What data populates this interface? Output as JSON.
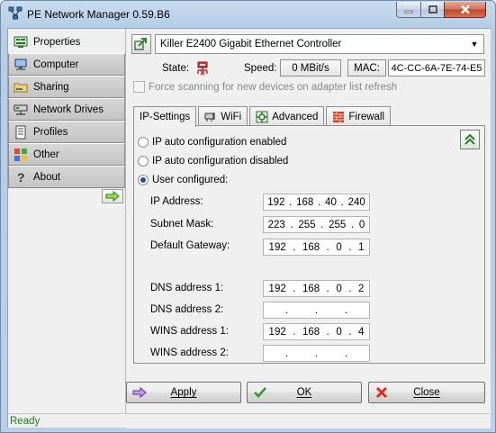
{
  "window": {
    "title": "PE Network Manager 0.59.B6"
  },
  "sidebar": {
    "items": [
      {
        "label": "Properties",
        "icon": "properties-icon"
      },
      {
        "label": "Computer",
        "icon": "computer-icon"
      },
      {
        "label": "Sharing",
        "icon": "sharing-icon"
      },
      {
        "label": "Network Drives",
        "icon": "network-drives-icon"
      },
      {
        "label": "Profiles",
        "icon": "profiles-icon"
      },
      {
        "label": "Other",
        "icon": "other-icon"
      },
      {
        "label": "About",
        "icon": "about-icon"
      }
    ],
    "active_index": 0
  },
  "adapter": {
    "selected": "Killer E2400 Gigabit Ethernet Controller",
    "state_label": "State:",
    "speed_label": "Speed:",
    "speed_value": "0 MBit/s",
    "mac_label": "MAC:",
    "mac_value": "4C-CC-6A-7E-74-E5",
    "force_scan_label": "Force scanning for new devices on adapter list refresh",
    "force_scan_checked": false,
    "force_scan_enabled": false
  },
  "tabs": [
    {
      "label": "IP-Settings",
      "active": true
    },
    {
      "label": "WiFi",
      "active": false
    },
    {
      "label": "Advanced",
      "active": false
    },
    {
      "label": "Firewall",
      "active": false
    }
  ],
  "ip_settings": {
    "radio_auto_enabled": "IP auto configuration enabled",
    "radio_auto_disabled": "IP auto configuration disabled",
    "radio_user": "User configured:",
    "selected_mode": "user",
    "ip_address_label": "IP Address:",
    "ip_address": [
      "192",
      "168",
      "40",
      "240"
    ],
    "subnet_mask_label": "Subnet Mask:",
    "subnet_mask": [
      "223",
      "255",
      "255",
      "0"
    ],
    "gateway_label": "Default Gateway:",
    "gateway": [
      "192",
      "168",
      "0",
      "1"
    ],
    "dns1_label": "DNS address 1:",
    "dns1": [
      "192",
      "168",
      "0",
      "2"
    ],
    "dns2_label": "DNS address 2:",
    "dns2": [
      "",
      "",
      "",
      ""
    ],
    "wins1_label": "WINS address 1:",
    "wins1": [
      "192",
      "168",
      "0",
      "4"
    ],
    "wins2_label": "WINS address 2:",
    "wins2": [
      "",
      "",
      "",
      ""
    ]
  },
  "buttons": {
    "apply": "Apply",
    "ok": "OK",
    "close": "Close"
  },
  "status": {
    "text": "Ready",
    "color": "#1d7a1d"
  }
}
